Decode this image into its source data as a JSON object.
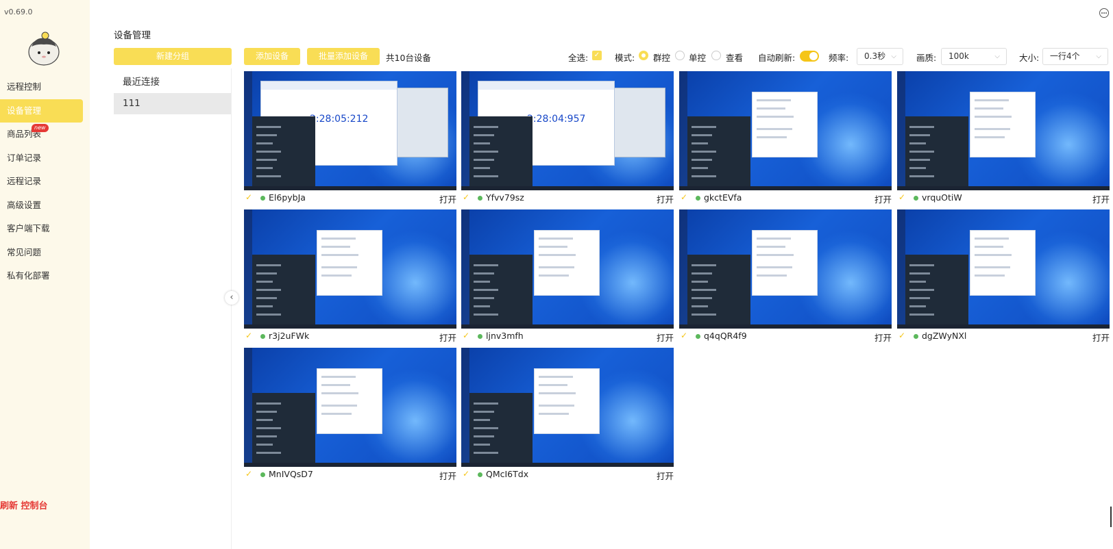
{
  "version": "v0.69.0",
  "sidebar": {
    "items": [
      {
        "label": "远程控制"
      },
      {
        "label": "设备管理"
      },
      {
        "label": "商品列表",
        "badge": "new"
      },
      {
        "label": "订单记录"
      },
      {
        "label": "远程记录"
      },
      {
        "label": "高级设置"
      },
      {
        "label": "客户端下载"
      },
      {
        "label": "常见问题"
      },
      {
        "label": "私有化部署"
      }
    ],
    "footer": "刷新 控制台"
  },
  "page_title": "设备管理",
  "header": {
    "new_group": "新建分组",
    "add_device": "添加设备",
    "batch_add": "批量添加设备",
    "device_count": "共10台设备"
  },
  "groups": [
    {
      "label": "最近连接"
    },
    {
      "label": "111"
    }
  ],
  "toolbar": {
    "select_all": "全选:",
    "mode": "模式:",
    "mode_group": "群控",
    "mode_single": "单控",
    "mode_view": "查看",
    "auto_refresh": "自动刷新:",
    "frequency_label": "频率:",
    "frequency": "0.3秒",
    "quality_label": "画质:",
    "quality": "100k",
    "size_label": "大小:",
    "size": "一行4个"
  },
  "clock_1": "2:28:05:212",
  "clock_2": "2:28:04:957",
  "devices": [
    {
      "name": "El6pybJa",
      "action": "打开"
    },
    {
      "name": "Yfvv79sz",
      "action": "打开"
    },
    {
      "name": "gkctEVfa",
      "action": "打开"
    },
    {
      "name": "vrquOtiW",
      "action": "打开"
    },
    {
      "name": "r3j2uFWk",
      "action": "打开"
    },
    {
      "name": "ljnv3mfh",
      "action": "打开"
    },
    {
      "name": "q4qQR4f9",
      "action": "打开"
    },
    {
      "name": "dgZWyNXl",
      "action": "打开"
    },
    {
      "name": "MnIVQsD7",
      "action": "打开"
    },
    {
      "name": "QMcI6Tdx",
      "action": "打开"
    }
  ],
  "colors": {
    "accent": "#f9dd55",
    "sidebar_bg": "#fdf9ea",
    "online": "#5cb85c",
    "danger": "#e53935"
  }
}
